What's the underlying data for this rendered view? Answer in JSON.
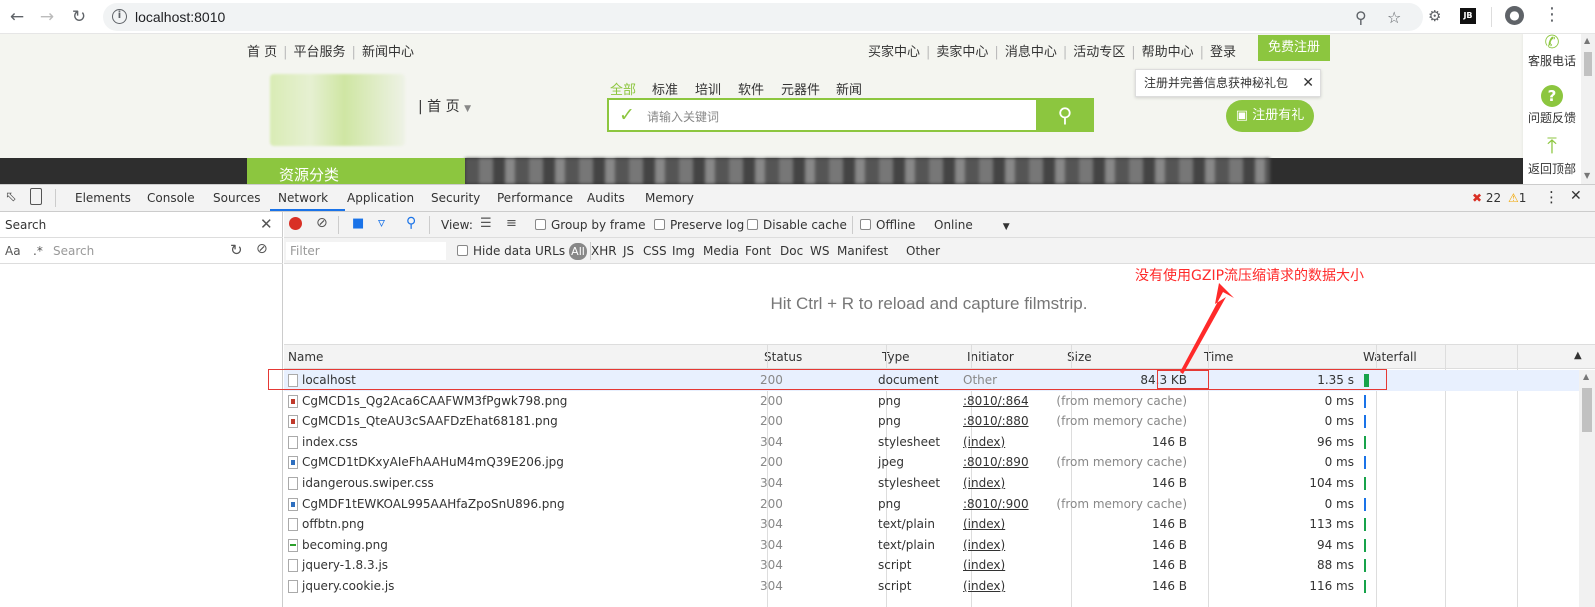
{
  "browser": {
    "url": "localhost:8010",
    "ext_badge": "JB"
  },
  "site": {
    "top_nav_left": [
      "首 页",
      "平台服务",
      "新闻中心"
    ],
    "top_nav_right": [
      "买家中心",
      "卖家中心",
      "消息中心",
      "活动专区",
      "帮助中心",
      "登录"
    ],
    "register_label": "免费注册",
    "home_label": "| 首 页",
    "search_tabs": [
      "全部",
      "标准",
      "培训",
      "软件",
      "元器件",
      "新闻"
    ],
    "search_placeholder": "请输入关键词",
    "tip_text": "注册并完善信息获神秘礼包",
    "gift_button": "注册有礼",
    "category_label": "资源分类",
    "sidebar": [
      "客服电话",
      "问题反馈",
      "返回顶部"
    ],
    "accent_color": "#8cc63f"
  },
  "devtools": {
    "tabs": [
      "Elements",
      "Console",
      "Sources",
      "Network",
      "Application",
      "Security",
      "Performance",
      "Audits",
      "Memory"
    ],
    "active_tab": "Network",
    "errors": "22",
    "warnings": "1",
    "search_pane": {
      "title": "Search",
      "case_label": "Aa",
      "regex_label": ".*",
      "placeholder": "Search"
    },
    "toolbar": {
      "view_label": "View:",
      "group_by_frame": "Group by frame",
      "preserve_log": "Preserve log",
      "disable_cache": "Disable cache",
      "offline": "Offline",
      "throttle": "Online"
    },
    "filter": {
      "placeholder": "Filter",
      "hide_data_urls": "Hide data URLs",
      "types": [
        "All",
        "XHR",
        "JS",
        "CSS",
        "Img",
        "Media",
        "Font",
        "Doc",
        "WS",
        "Manifest",
        "Other"
      ]
    },
    "filmstrip_message": "Hit Ctrl + R to reload and capture filmstrip.",
    "columns": [
      "Name",
      "Status",
      "Type",
      "Initiator",
      "Size",
      "Time",
      "Waterfall"
    ],
    "rows": [
      {
        "name": "localhost",
        "status": "200",
        "type": "document",
        "initiator": "Other",
        "size": "84.3 KB",
        "time": "1.35 s",
        "icon": "doc-icon"
      },
      {
        "name": "CgMCD1s_Qg2Aca6CAAFWM3fPgwk798.png",
        "status": "200",
        "type": "png",
        "initiator": ":8010/:864",
        "size": "(from memory cache)",
        "time": "0 ms",
        "icon": "image-red-icon"
      },
      {
        "name": "CgMCD1s_QteAU3cSAAFDzEhat68181.png",
        "status": "200",
        "type": "png",
        "initiator": ":8010/:880",
        "size": "(from memory cache)",
        "time": "0 ms",
        "icon": "image-red-icon"
      },
      {
        "name": "index.css",
        "status": "304",
        "type": "stylesheet",
        "initiator": "(index)",
        "size": "146 B",
        "time": "96 ms",
        "icon": "doc-icon"
      },
      {
        "name": "CgMCD1tDKxyAIeFhAAHuM4mQ39E206.jpg",
        "status": "200",
        "type": "jpeg",
        "initiator": ":8010/:890",
        "size": "(from memory cache)",
        "time": "0 ms",
        "icon": "image-blue-icon"
      },
      {
        "name": "idangerous.swiper.css",
        "status": "304",
        "type": "stylesheet",
        "initiator": "(index)",
        "size": "146 B",
        "time": "104 ms",
        "icon": "doc-icon"
      },
      {
        "name": "CgMDF1tEWKOAL995AAHfaZpoSnU896.png",
        "status": "200",
        "type": "png",
        "initiator": ":8010/:900",
        "size": "(from memory cache)",
        "time": "0 ms",
        "icon": "image-blue-icon"
      },
      {
        "name": "offbtn.png",
        "status": "304",
        "type": "text/plain",
        "initiator": "(index)",
        "size": "146 B",
        "time": "113 ms",
        "icon": "doc-icon"
      },
      {
        "name": "becoming.png",
        "status": "304",
        "type": "text/plain",
        "initiator": "(index)",
        "size": "146 B",
        "time": "94 ms",
        "icon": "image-green-icon"
      },
      {
        "name": "jquery-1.8.3.js",
        "status": "304",
        "type": "script",
        "initiator": "(index)",
        "size": "146 B",
        "time": "88 ms",
        "icon": "doc-icon"
      },
      {
        "name": "jquery.cookie.js",
        "status": "304",
        "type": "script",
        "initiator": "(index)",
        "size": "146 B",
        "time": "116 ms",
        "icon": "doc-icon"
      }
    ]
  },
  "annotation": {
    "text": "没有使用GZIP流压缩请求的数据大小",
    "color": "#ff2a2a"
  }
}
